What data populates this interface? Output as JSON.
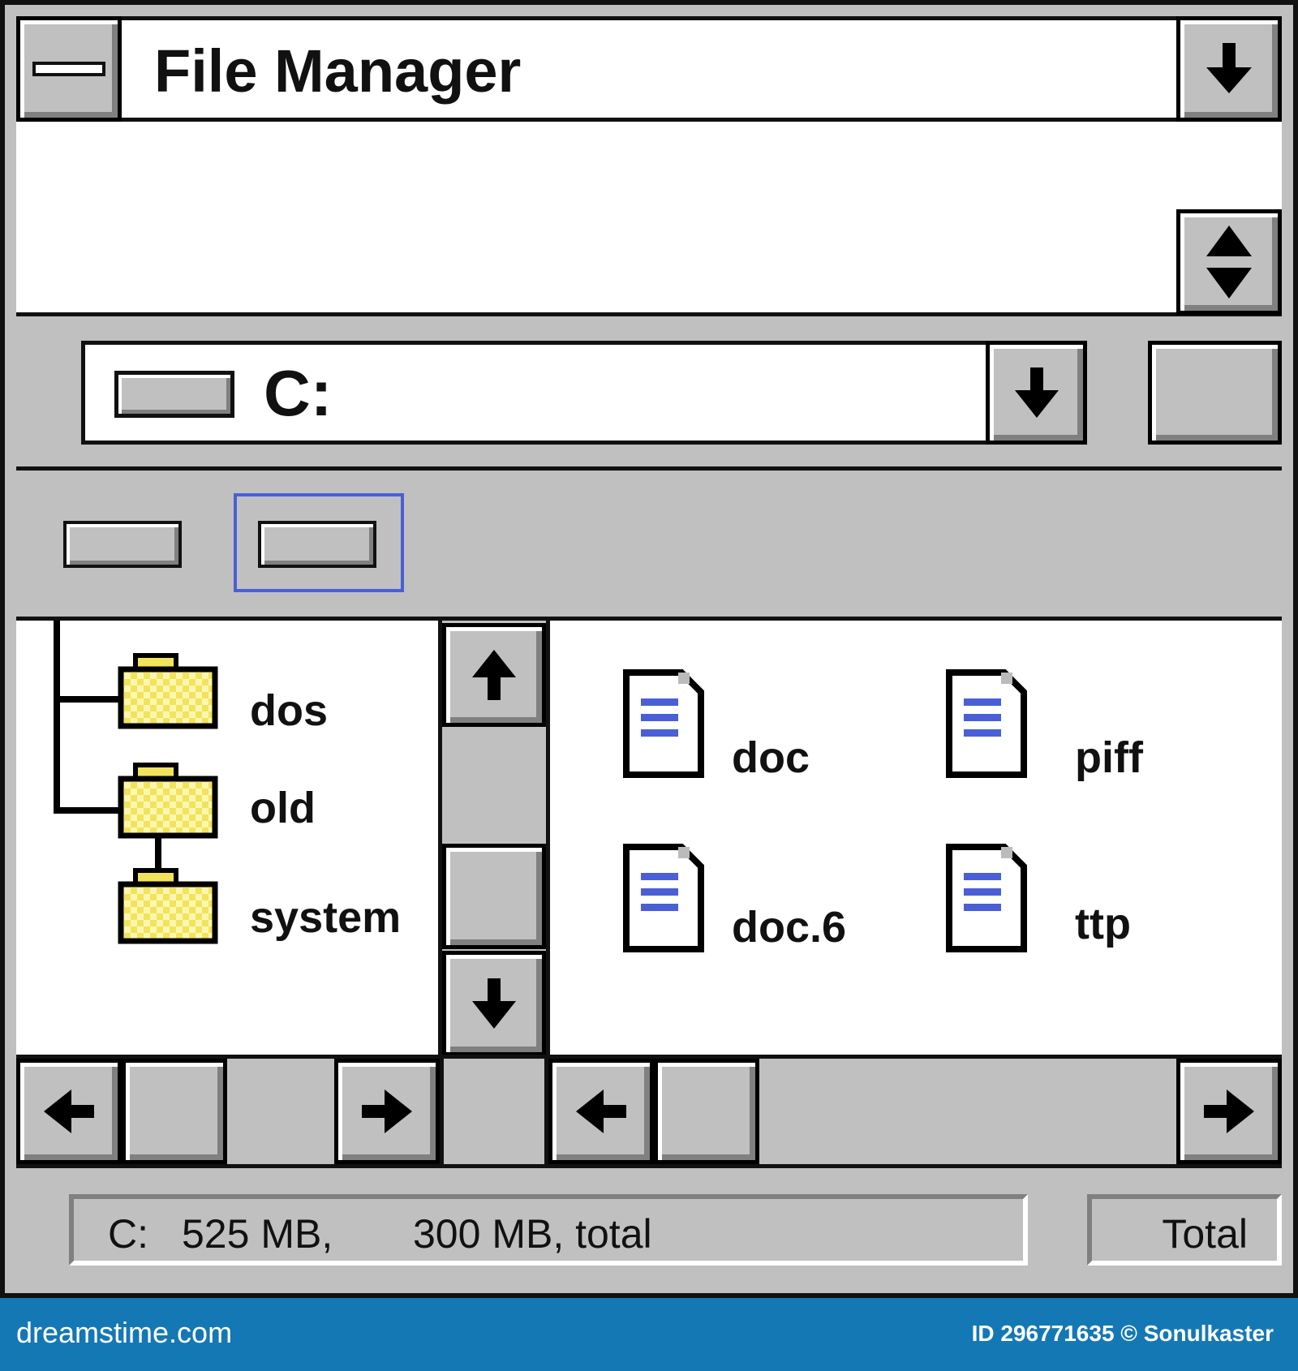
{
  "window": {
    "title": "File Manager"
  },
  "drive_bar": {
    "drive_label": "C:"
  },
  "tree": {
    "items": [
      {
        "label": "dos"
      },
      {
        "label": "old"
      },
      {
        "label": "system"
      }
    ]
  },
  "files": {
    "items": [
      {
        "label": "doc"
      },
      {
        "label": "piff"
      },
      {
        "label": "doc.6"
      },
      {
        "label": "ttp"
      }
    ]
  },
  "status": {
    "drive": "C:",
    "free": "525 MB,",
    "total_text": "300 MB, total",
    "total_button": "Total"
  },
  "footer": {
    "site": "dreamstime.com",
    "credit": "ID 296771635 © Sonulkaster"
  },
  "colors": {
    "window_gray": "#c0c0c0",
    "focus_outline": "#4a5fd6",
    "folder_yellow": "#f2e35c",
    "doc_lines": "#4a5fd6",
    "footer_blue": "#1478b4"
  }
}
